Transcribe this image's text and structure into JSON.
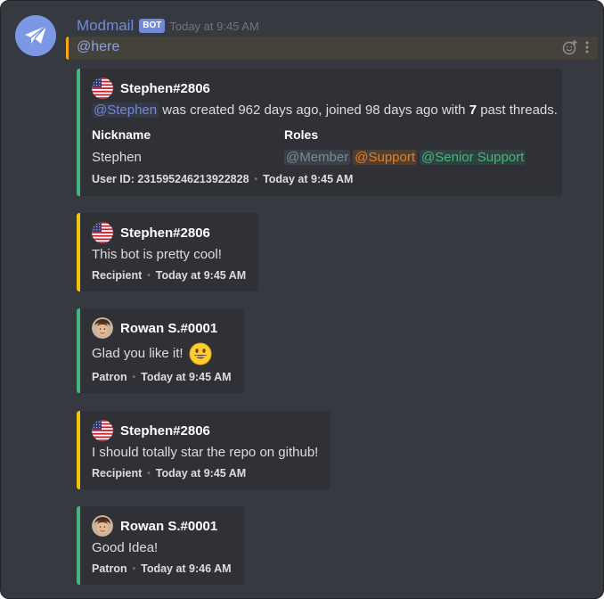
{
  "header": {
    "username": "Modmail",
    "bot_tag": "BOT",
    "timestamp": "Today at 9:45 AM",
    "mention": "@here"
  },
  "info_embed": {
    "author": "Stephen#2806",
    "mention": "@Stephen",
    "description_middle": " was created 962 days ago, joined 98 days ago with ",
    "past_threads": "7",
    "description_end": " past threads.",
    "nickname_label": "Nickname",
    "nickname_value": "Stephen",
    "roles_label": "Roles",
    "roles": [
      {
        "name": "@Member",
        "color": "#778995",
        "bg": "rgba(119,137,149,0.18)"
      },
      {
        "name": "@Support",
        "color": "#e67e22",
        "bg": "rgba(230,126,34,0.18)"
      },
      {
        "name": "@Senior Support",
        "color": "#43b581",
        "bg": "rgba(67,181,129,0.12)"
      }
    ],
    "footer_id": "User ID: 231595246213922828",
    "footer_time": "Today at 9:45 AM"
  },
  "messages": [
    {
      "author": "Stephen#2806",
      "text": "This bot is pretty cool!",
      "role": "Recipient",
      "time": "Today at 9:45 AM"
    },
    {
      "author": "Rowan S.#0001",
      "text": "Glad you like it!",
      "role": "Patron",
      "time": "Today at 9:45 AM"
    },
    {
      "author": "Stephen#2806",
      "text": "I should totally star the repo on github!",
      "role": "Recipient",
      "time": "Today at 9:45 AM"
    },
    {
      "author": "Rowan S.#0001",
      "text": "Good Idea!",
      "role": "Patron",
      "time": "Today at 9:46 AM"
    }
  ],
  "colors": {
    "background": "#36393f",
    "embed_background": "#2f3136",
    "user_border": "#f1c40f",
    "support_border": "#43b581",
    "mention_highlight": "#faa61a",
    "blurple": "#7289da"
  },
  "icons": {
    "bot_avatar": "envelope-icon",
    "add_reaction": "add-reaction-icon",
    "more": "more-options-icon",
    "flag": "us-flag-icon",
    "smile": "grinning-emoji-icon"
  }
}
